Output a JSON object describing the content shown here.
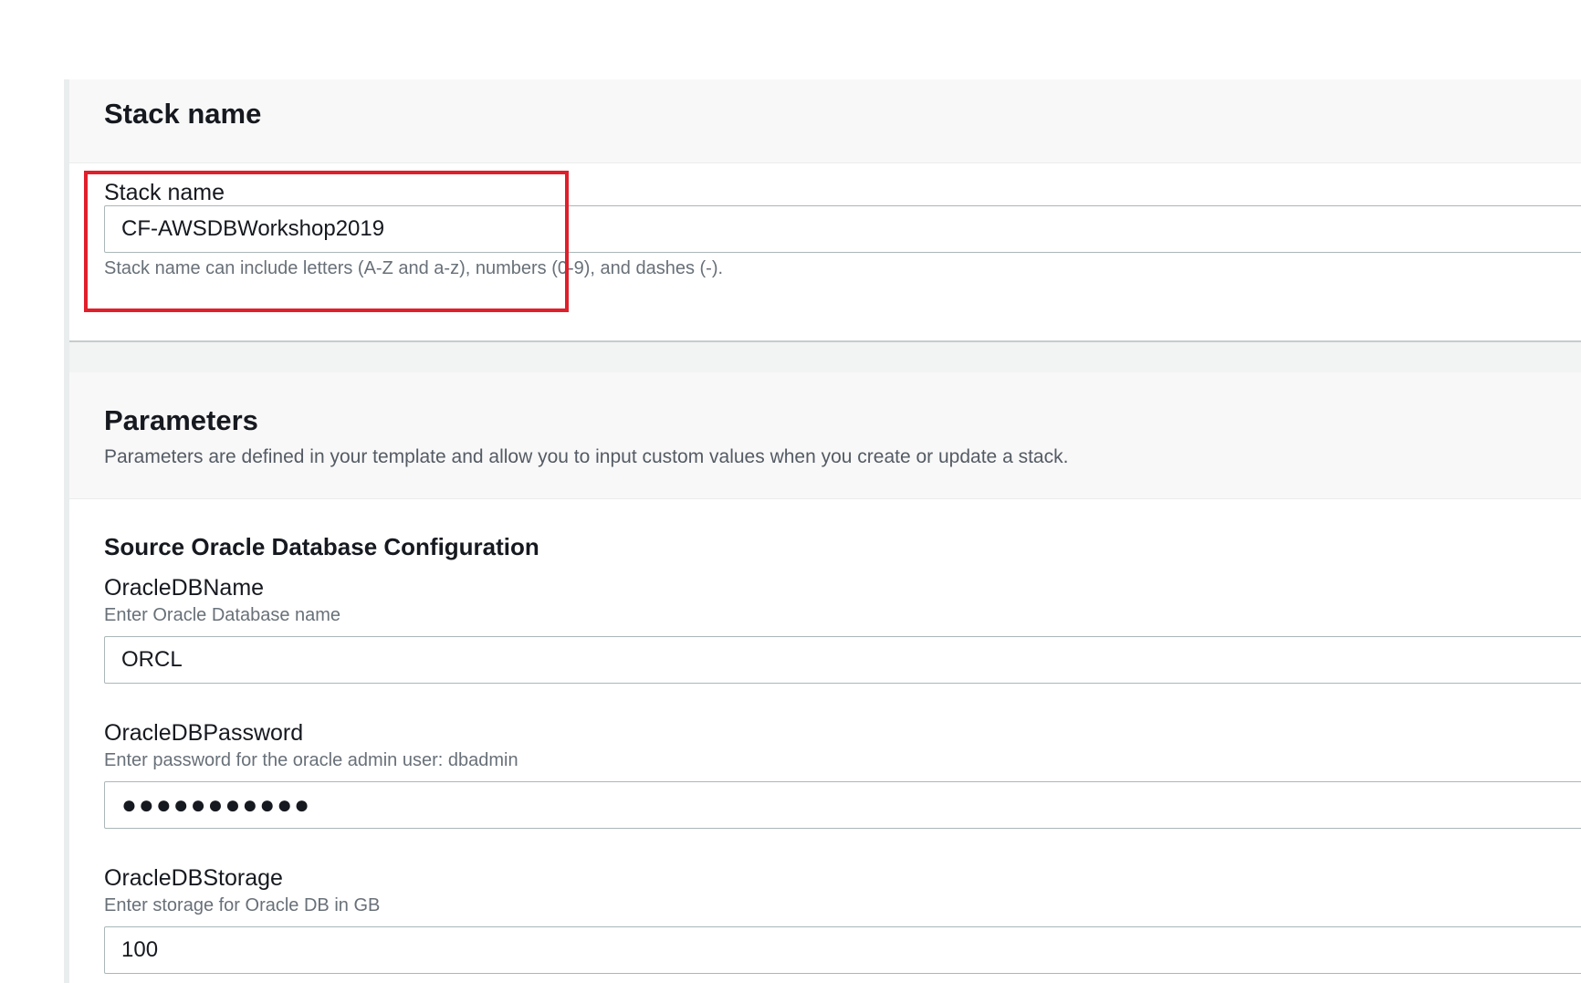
{
  "stack_name_panel": {
    "title": "Stack name",
    "field_label": "Stack name",
    "field_value": "CF-AWSDBWorkshop2019",
    "constraint_text": "Stack name can include letters (A-Z and a-z), numbers (0-9), and dashes (-)."
  },
  "parameters_panel": {
    "title": "Parameters",
    "description": "Parameters are defined in your template and allow you to input custom values when you create or update a stack.",
    "section_title": "Source Oracle Database Configuration",
    "fields": [
      {
        "label": "OracleDBName",
        "description": "Enter Oracle Database name",
        "value": "ORCL"
      },
      {
        "label": "OracleDBPassword",
        "description": "Enter password for the oracle admin user: dbadmin",
        "value": "●●●●●●●●●●●"
      },
      {
        "label": "OracleDBStorage",
        "description": "Enter storage for Oracle DB in GB",
        "value": "100"
      }
    ]
  },
  "colors": {
    "highlight": "#e01f2b",
    "header_bg": "#f8f8f8",
    "text_primary": "#16191f",
    "text_secondary": "#687078",
    "input_border": "#aab7b8"
  }
}
